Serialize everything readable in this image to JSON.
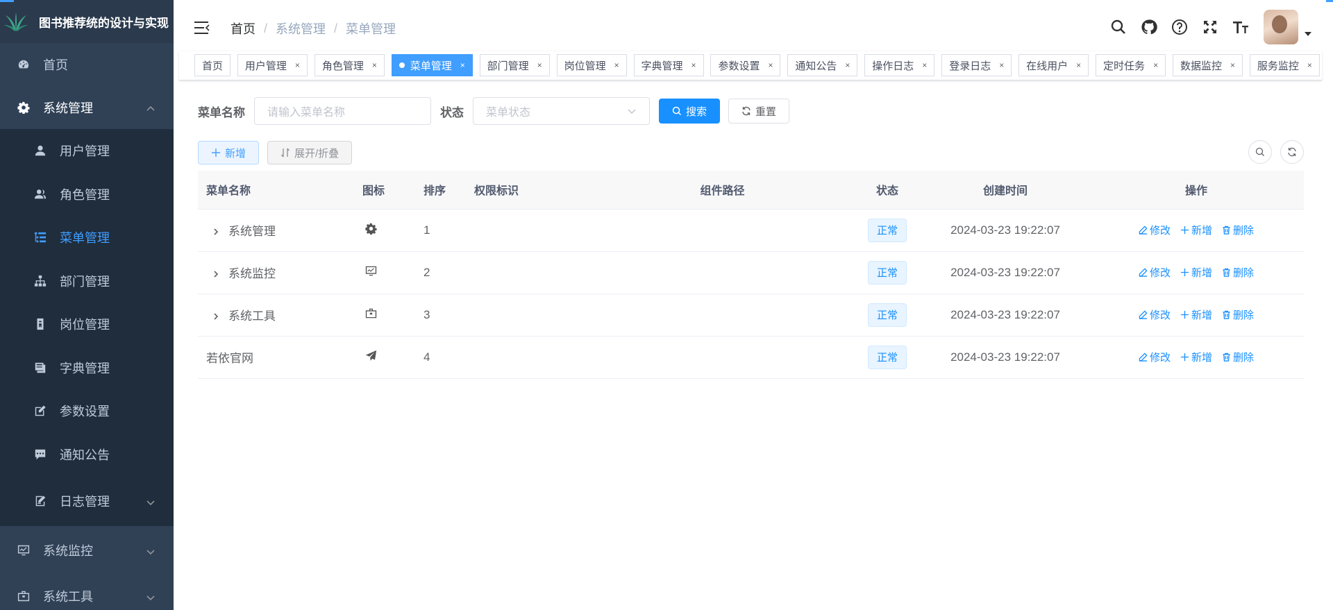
{
  "app": {
    "title": "图书推荐统的设计与实现"
  },
  "sidebar": {
    "home": "首页",
    "system": "系统管理",
    "sub_items": [
      {
        "label": "用户管理",
        "icon": "user-icon"
      },
      {
        "label": "角色管理",
        "icon": "peoples-icon"
      },
      {
        "label": "菜单管理",
        "icon": "tree-table-icon"
      },
      {
        "label": "部门管理",
        "icon": "tree-icon"
      },
      {
        "label": "岗位管理",
        "icon": "post-icon"
      },
      {
        "label": "字典管理",
        "icon": "dict-icon"
      },
      {
        "label": "参数设置",
        "icon": "edit-icon"
      },
      {
        "label": "通知公告",
        "icon": "message-icon"
      },
      {
        "label": "日志管理",
        "icon": "log-icon"
      }
    ],
    "monitor": "系统监控",
    "tools": "系统工具"
  },
  "breadcrumb": [
    "首页",
    "系统管理",
    "菜单管理"
  ],
  "tags": [
    "首页",
    "用户管理",
    "角色管理",
    "菜单管理",
    "部门管理",
    "岗位管理",
    "字典管理",
    "参数设置",
    "通知公告",
    "操作日志",
    "登录日志",
    "在线用户",
    "定时任务",
    "数据监控",
    "服务监控"
  ],
  "search": {
    "name_label": "菜单名称",
    "name_placeholder": "请输入菜单名称",
    "status_label": "状态",
    "status_placeholder": "菜单状态",
    "search_btn": "搜索",
    "reset_btn": "重置"
  },
  "toolbar": {
    "add_btn": "新增",
    "expand_btn": "展开/折叠"
  },
  "table": {
    "headers": [
      "菜单名称",
      "图标",
      "排序",
      "权限标识",
      "组件路径",
      "状态",
      "创建时间",
      "操作"
    ],
    "rows": [
      {
        "name": "系统管理",
        "icon": "gear-icon",
        "order": "1",
        "perm": "",
        "component": "",
        "status": "正常",
        "created": "2024-03-23 19:22:07",
        "expandable": true
      },
      {
        "name": "系统监控",
        "icon": "monitor-icon",
        "order": "2",
        "perm": "",
        "component": "",
        "status": "正常",
        "created": "2024-03-23 19:22:07",
        "expandable": true
      },
      {
        "name": "系统工具",
        "icon": "toolbox-icon",
        "order": "3",
        "perm": "",
        "component": "",
        "status": "正常",
        "created": "2024-03-23 19:22:07",
        "expandable": true
      },
      {
        "name": "若依官网",
        "icon": "send-icon",
        "order": "4",
        "perm": "",
        "component": "",
        "status": "正常",
        "created": "2024-03-23 19:22:07",
        "expandable": false
      }
    ],
    "ops": {
      "edit": "修改",
      "add": "新增",
      "delete": "删除"
    }
  },
  "colors": {
    "sidebar_bg": "#304156",
    "submenu_bg": "#1f2d3d",
    "primary": "#1890ff",
    "active_menu": "#409eff"
  }
}
